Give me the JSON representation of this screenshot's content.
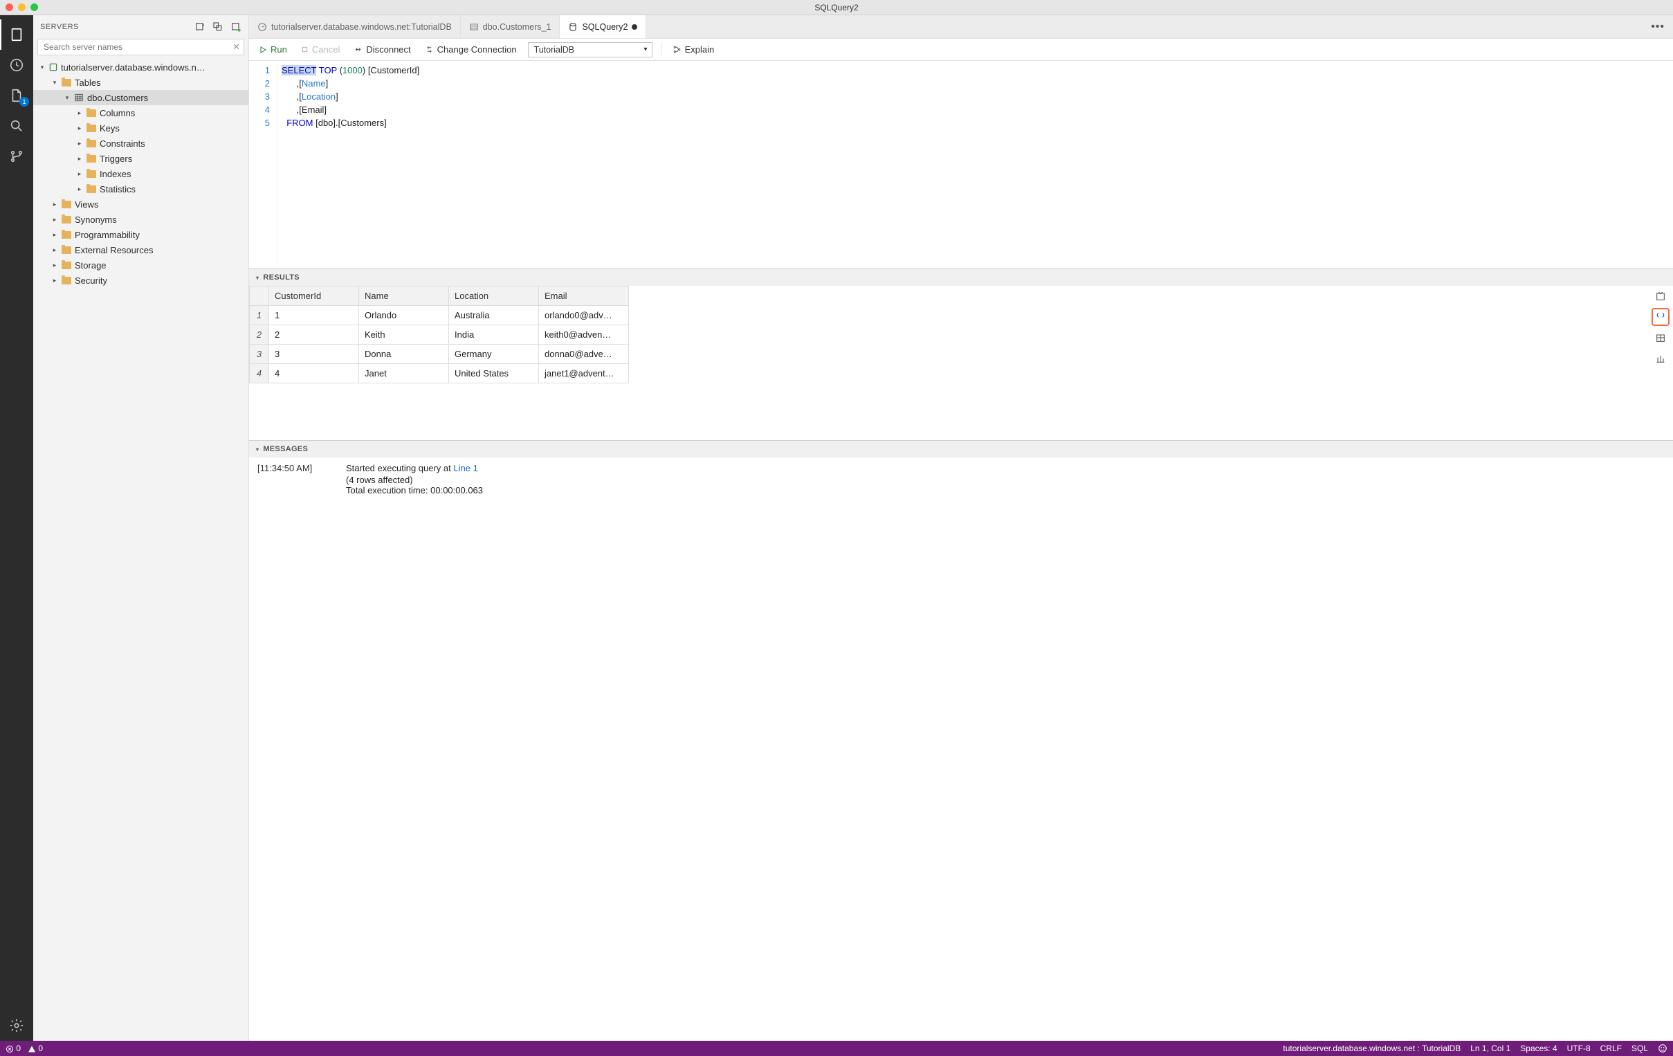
{
  "window": {
    "title": "SQLQuery2"
  },
  "activitybar": {
    "items": [
      {
        "name": "servers",
        "active": true
      },
      {
        "name": "tasks"
      },
      {
        "name": "explorer",
        "badge": "1"
      },
      {
        "name": "search"
      },
      {
        "name": "source-control"
      }
    ]
  },
  "sidebar": {
    "title": "SERVERS",
    "search_placeholder": "Search server names",
    "server_label": "tutorialserver.database.windows.n…",
    "nodes": {
      "tables": "Tables",
      "customers": "dbo.Customers",
      "columns": "Columns",
      "keys": "Keys",
      "constraints": "Constraints",
      "triggers": "Triggers",
      "indexes": "Indexes",
      "statistics": "Statistics",
      "views": "Views",
      "synonyms": "Synonyms",
      "programmability": "Programmability",
      "external_resources": "External Resources",
      "storage": "Storage",
      "security": "Security"
    }
  },
  "tabs": {
    "dashboard": "tutorialserver.database.windows.net:TutorialDB",
    "t1": "dbo.Customers_1",
    "t2": "SQLQuery2"
  },
  "toolbar": {
    "run": "Run",
    "cancel": "Cancel",
    "disconnect": "Disconnect",
    "change_connection": "Change Connection",
    "explain": "Explain",
    "db_selected": "TutorialDB"
  },
  "editor": {
    "lines": [
      "1",
      "2",
      "3",
      "4",
      "5"
    ],
    "code": {
      "l1_kw1": "SELECT",
      "l1_kw2": "TOP",
      "l1_num": "1000",
      "l1_rest": ") [CustomerId]",
      "l2_pre": "      ,[",
      "l2_id": "Name",
      "l2_post": "]",
      "l3_pre": "      ,[",
      "l3_id": "Location",
      "l3_post": "]",
      "l4": "      ,[Email]",
      "l5_kw": "  FROM",
      "l5_rest": " [dbo].[Customers]"
    }
  },
  "results": {
    "title": "RESULTS",
    "columns": [
      "CustomerId",
      "Name",
      "Location",
      "Email"
    ],
    "rows": [
      {
        "n": "1",
        "cells": [
          "1",
          "Orlando",
          "Australia",
          "orlando0@adv…"
        ]
      },
      {
        "n": "2",
        "cells": [
          "2",
          "Keith",
          "India",
          "keith0@adven…"
        ]
      },
      {
        "n": "3",
        "cells": [
          "3",
          "Donna",
          "Germany",
          "donna0@adve…"
        ]
      },
      {
        "n": "4",
        "cells": [
          "4",
          "Janet",
          "United States",
          "janet1@advent…"
        ]
      }
    ]
  },
  "messages": {
    "title": "MESSAGES",
    "timestamp": "[11:34:50 AM]",
    "line1_pre": "Started executing query at ",
    "line1_link": "Line 1",
    "line2": "(4 rows affected)",
    "line3": "Total execution time: 00:00:00.063"
  },
  "statusbar": {
    "errors": "0",
    "warnings": "0",
    "connection": "tutorialserver.database.windows.net : TutorialDB",
    "position": "Ln 1, Col 1",
    "spaces": "Spaces: 4",
    "encoding": "UTF-8",
    "eol": "CRLF",
    "lang": "SQL"
  }
}
